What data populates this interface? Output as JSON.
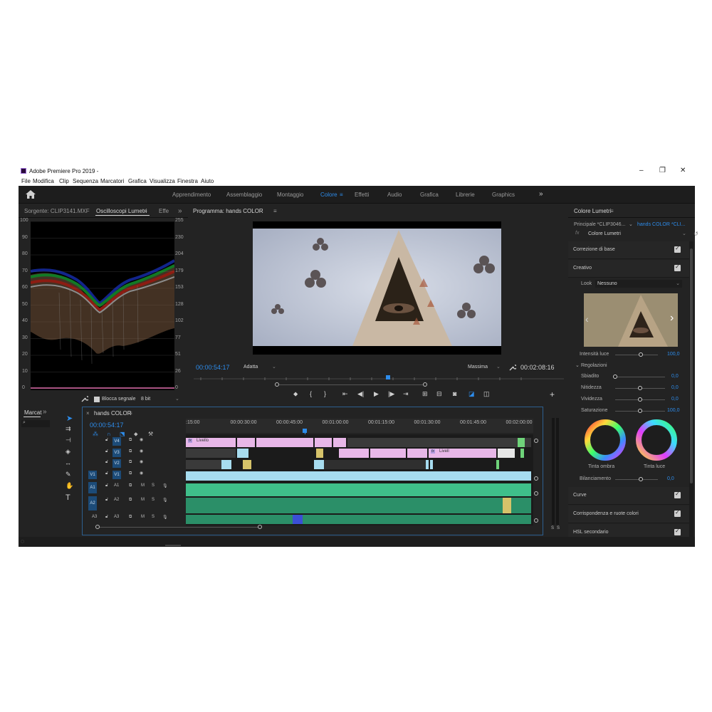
{
  "app": {
    "title": "Adobe Premiere Pro 2019 -",
    "menu": [
      "File",
      "Modifica",
      "Clip",
      "Sequenza",
      "Marcatori",
      "Grafica",
      "Visualizza",
      "Finestra",
      "Aiuto"
    ]
  },
  "workspaces": {
    "items": [
      "Apprendimento",
      "Assemblaggio",
      "Montaggio",
      "Colore",
      "Effetti",
      "Audio",
      "Grafica",
      "Librerie",
      "Graphics"
    ],
    "active": "Colore",
    "more_glyph": "»"
  },
  "scopes_panel": {
    "tab_source": "Sorgente: CLIP3141.MXF",
    "tab_scopes": "Oscilloscopi Lumetri",
    "tab_effects": "Effe",
    "left_scale": [
      "100",
      "90",
      "80",
      "70",
      "60",
      "50",
      "40",
      "30",
      "20",
      "10",
      "0"
    ],
    "right_scale": [
      "255",
      "230",
      "204",
      "179",
      "153",
      "128",
      "102",
      "77",
      "51",
      "26",
      "0"
    ],
    "clamp_signal": "Blocca segnale",
    "bit_depth": "8 bit"
  },
  "program_monitor": {
    "tab": "Programma: hands COLOR",
    "current_time": "00:00:54:17",
    "fit": "Adatta",
    "quality": "Massima",
    "duration": "00:02:08:16"
  },
  "lumetri": {
    "tab": "Colore Lumetri",
    "master": "Principale *CLIP3046...",
    "clip": "hands COLOR *CLI...",
    "effect": "Colore Lumetri",
    "basic": "Correzione di base",
    "creative": "Creativo",
    "look_label": "Look",
    "look_value": "Nessuno",
    "intensity_label": "Intensità luce",
    "intensity_value": "100,0",
    "adjustments": "Regolazioni",
    "sliders": [
      {
        "label": "Sbiadito",
        "value": "0,0",
        "level": 0.0
      },
      {
        "label": "Nitidezza",
        "value": "0,0",
        "level": 0.5
      },
      {
        "label": "Vividezza",
        "value": "0,0",
        "level": 0.5
      },
      {
        "label": "Saturazione",
        "value": "100,0",
        "level": 0.5
      }
    ],
    "wheel_shadow": "Tinta ombra",
    "wheel_highlight": "Tinta luce",
    "balance_label": "Bilanciamento",
    "balance_value": "0,0",
    "sections": [
      "Curve",
      "Corrispondenza e ruote colori",
      "HSL secondario"
    ]
  },
  "markers_panel": {
    "tab": "Marcat"
  },
  "timeline": {
    "tab": "hands COLOR",
    "current_time": "00:00:54:17",
    "ruler": [
      ":15:00",
      "00:00:30:00",
      "00:00:45:00",
      "00:01:00:00",
      "00:01:15:00",
      "00:01:30:00",
      "00:01:45:00",
      "00:02:00:00"
    ],
    "video_tracks": [
      "V4",
      "V3",
      "V2",
      "V1"
    ],
    "audio_tracks": [
      "A1",
      "A2",
      "A3"
    ],
    "source_video": "V1",
    "source_audio": [
      "A1",
      "A2"
    ],
    "clip_label_1": "Livello",
    "clip_label_2": "Livell",
    "fx": "fx",
    "meter_labels": [
      "S",
      "S"
    ],
    "m_label": "M",
    "s_label": "S"
  },
  "colors": {
    "accent": "#2d8ceb",
    "video_clip": "#e8b7e8",
    "video_clip_cyan": "#a7dcef",
    "audio_clip": "#3fbf8a"
  }
}
